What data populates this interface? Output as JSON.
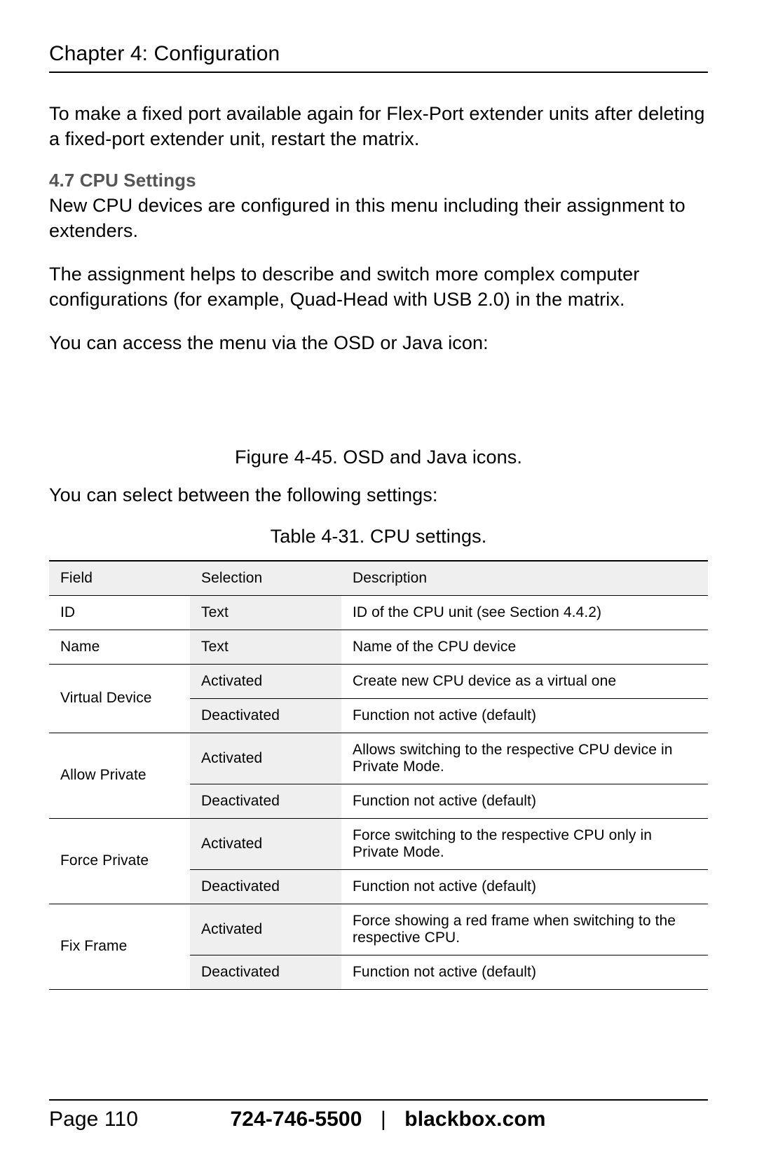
{
  "header": {
    "chapter_title": "Chapter 4: Configuration"
  },
  "body": {
    "intro_para": "To make a fixed port available again for Flex-Port extender units after deleting a fixed-port extender unit, restart the matrix.",
    "section_heading": "4.7 CPU Settings",
    "para1": "New CPU devices are configured in this menu including their assignment to extenders.",
    "para2": "The assignment helps to describe and switch more complex computer configurations (for example, Quad-Head with USB 2.0) in the matrix.",
    "para3": "You can access the menu via the OSD or Java icon:",
    "figure_caption": "Figure 4-45. OSD and Java icons.",
    "para4": "You can select between the following settings:",
    "table_caption": "Table 4-31. CPU settings."
  },
  "table": {
    "headers": {
      "field": "Field",
      "selection": "Selection",
      "description": "Description"
    },
    "rows": {
      "id": {
        "field": "ID",
        "sel": "Text",
        "desc": "ID of the CPU unit (see Section 4.4.2)"
      },
      "name": {
        "field": "Name",
        "sel": "Text",
        "desc": "Name of the CPU device"
      },
      "virtual": {
        "field": "Virtual Device",
        "a_sel": "Activated",
        "a_desc": "Create new CPU device as a virtual one",
        "d_sel": "Deactivated",
        "d_desc": "Function not active (default)"
      },
      "allow": {
        "field": "Allow Private",
        "a_sel": "Activated",
        "a_desc": "Allows switching to the respective CPU device in Private Mode.",
        "d_sel": "Deactivated",
        "d_desc": "Function not active (default)"
      },
      "force": {
        "field": "Force Private",
        "a_sel": "Activated",
        "a_desc": "Force switching to the respective CPU only in Private Mode.",
        "d_sel": "Deactivated",
        "d_desc": "Function not active (default)"
      },
      "fix": {
        "field": "Fix Frame",
        "a_sel": "Activated",
        "a_desc": "Force showing a red frame when switching to the respective CPU.",
        "d_sel": "Deactivated",
        "d_desc": "Function not active (default)"
      }
    }
  },
  "footer": {
    "page_label": "Page 110",
    "phone": "724-746-5500",
    "separator": "|",
    "site": "blackbox.com"
  }
}
